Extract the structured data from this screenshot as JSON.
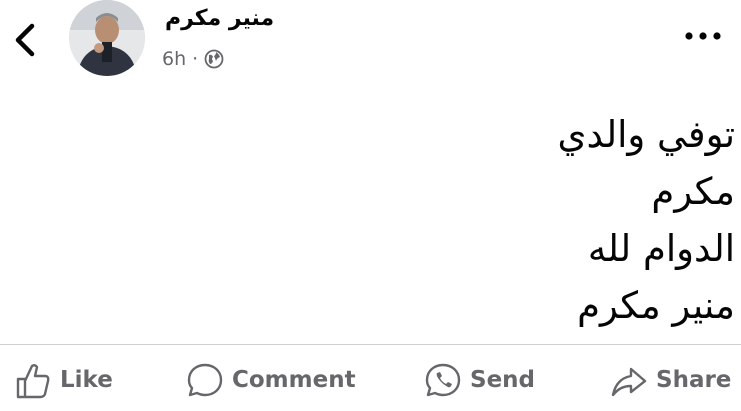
{
  "post": {
    "author": "منير مكرم",
    "time": "6h",
    "separator": "·",
    "privacy_icon": "globe-icon",
    "body_lines": [
      "توفي والدي",
      "مكرم",
      "الدوام لله",
      "منير مكرم"
    ]
  },
  "header": {
    "back_icon": "chevron-left-icon",
    "more_icon": "more-horizontal-icon"
  },
  "actions": [
    {
      "label": "Like",
      "icon": "thumbs-up-icon"
    },
    {
      "label": "Comment",
      "icon": "comment-bubble-icon"
    },
    {
      "label": "Send",
      "icon": "messenger-icon"
    },
    {
      "label": "Share",
      "icon": "share-arrow-icon"
    }
  ],
  "colors": {
    "text": "#050505",
    "secondary_text": "#65676b",
    "divider": "#ced0d4"
  }
}
